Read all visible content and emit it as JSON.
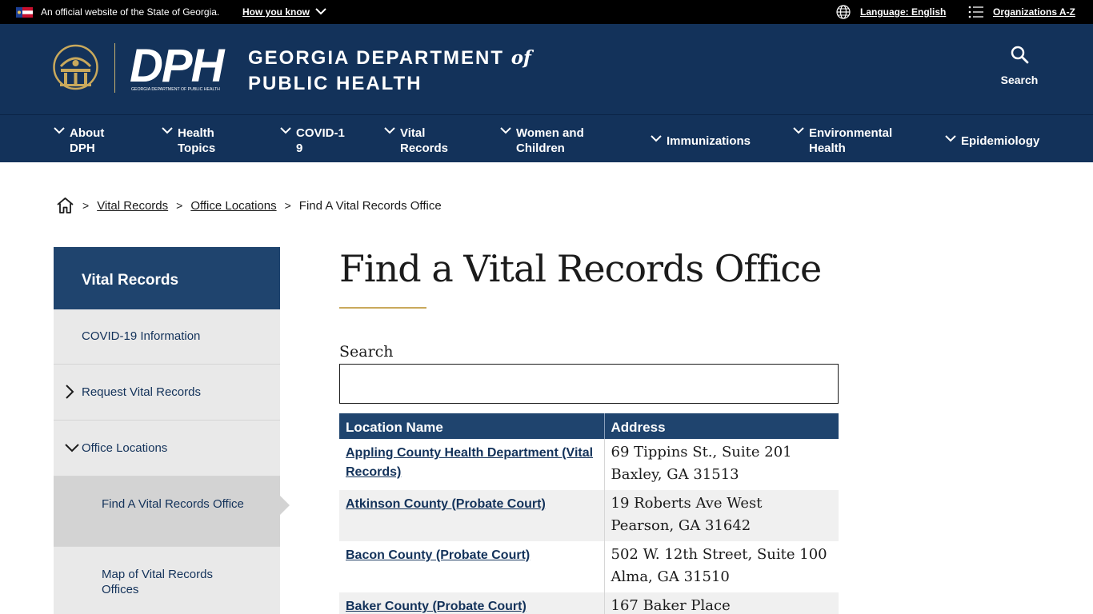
{
  "topbar": {
    "official_text": "An official website of the State of Georgia.",
    "how_you_know": "How you know",
    "language": "Language: English",
    "organizations": "Organizations A-Z"
  },
  "header": {
    "agency_line1": "GEORGIA DEPARTMENT",
    "agency_of": "of",
    "agency_line2": "PUBLIC HEALTH",
    "logo_text": "DPH",
    "logo_subtext": "GEORGIA DEPARTMENT OF PUBLIC HEALTH",
    "search_label": "Search"
  },
  "nav": {
    "items": [
      {
        "label": "About DPH"
      },
      {
        "label": "Health Topics"
      },
      {
        "label": "COVID-19"
      },
      {
        "label": "Vital Records"
      },
      {
        "label": "Women and Children"
      },
      {
        "label": "Immunizations"
      },
      {
        "label": "Environmental Health"
      },
      {
        "label": "Epidemiology"
      }
    ]
  },
  "breadcrumb": {
    "home_label": "Home",
    "items": [
      "Vital Records",
      "Office Locations"
    ],
    "current": "Find A Vital Records Office"
  },
  "sidebar": {
    "heading": "Vital Records",
    "items": [
      {
        "label": "COVID-19 Information"
      },
      {
        "label": "Request Vital Records"
      },
      {
        "label": "Office Locations"
      },
      {
        "label": "Find A Vital Records Office"
      },
      {
        "label": "Map of Vital Records Offices"
      }
    ]
  },
  "main": {
    "title": "Find a Vital Records Office",
    "search_label": "Search",
    "search_value": "",
    "columns": [
      "Location Name",
      "Address"
    ],
    "rows": [
      {
        "name": "Appling County Health Department (Vital Records)",
        "addr1": "69 Tippins St., Suite 201",
        "addr2": "Baxley, GA 31513"
      },
      {
        "name": "Atkinson County (Probate Court)",
        "addr1": "19 Roberts Ave West",
        "addr2": "Pearson, GA 31642"
      },
      {
        "name": "Bacon County (Probate Court)",
        "addr1": "502 W. 12th Street, Suite 100",
        "addr2": "Alma, GA 31510"
      },
      {
        "name": "Baker County (Probate Court)",
        "addr1": "167 Baker Place",
        "addr2": ""
      }
    ]
  },
  "colors": {
    "navy": "#13325a",
    "sidebar_head": "#1f446e",
    "gold": "#c9a95c",
    "sidebar_bg": "#e9e9e9"
  }
}
